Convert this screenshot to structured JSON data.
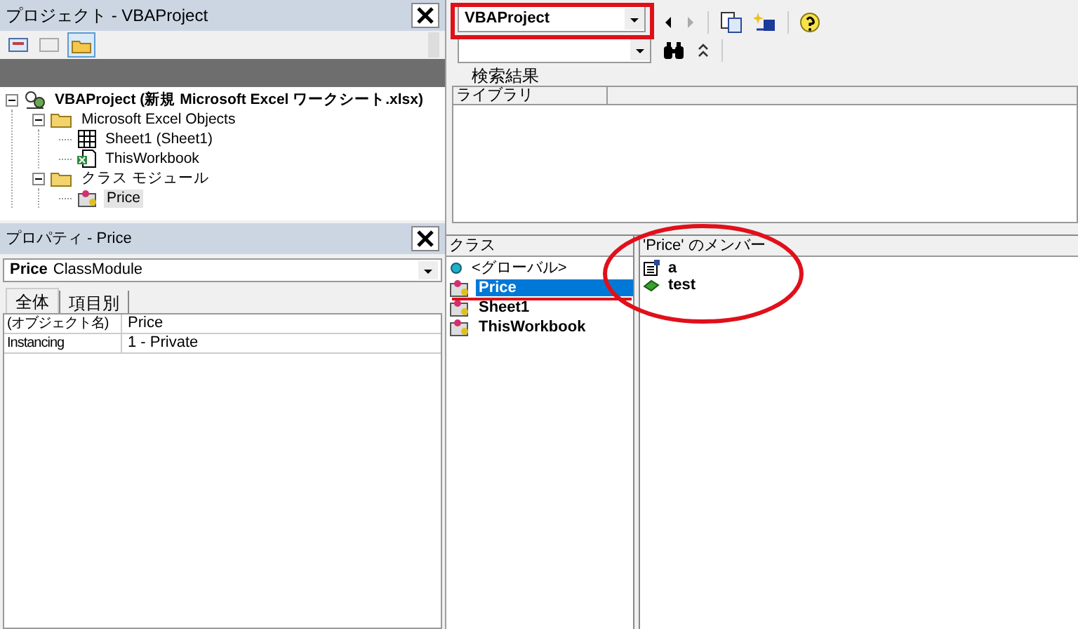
{
  "project_window": {
    "title": "プロジェクト - VBAProject",
    "tree": [
      {
        "label": "VBAProject (新規 Microsoft Excel ワークシート.xlsx)",
        "kind": "project",
        "expanded": true,
        "selected": false,
        "children": [
          {
            "label": "Microsoft Excel Objects",
            "kind": "folder",
            "expanded": true,
            "selected": false,
            "children": [
              {
                "label": "Sheet1 (Sheet1)",
                "kind": "sheet",
                "selected": false
              },
              {
                "label": "ThisWorkbook",
                "kind": "workbook",
                "selected": false
              }
            ]
          },
          {
            "label": "クラス モジュール",
            "kind": "folder",
            "expanded": true,
            "selected": false,
            "children": [
              {
                "label": "Price",
                "kind": "class",
                "selected": true
              }
            ]
          }
        ]
      }
    ]
  },
  "properties_window": {
    "title": "プロパティ - Price",
    "object": {
      "name": "Price",
      "type": "ClassModule"
    },
    "tabs": [
      {
        "label": "全体",
        "selected": true
      },
      {
        "label": "項目別",
        "selected": false
      }
    ],
    "rows": [
      {
        "name": "(オブジェクト名)",
        "value": "Price"
      },
      {
        "name": "Instancing",
        "value": "1 - Private"
      }
    ]
  },
  "object_browser": {
    "library": "VBAProject",
    "search_results_label": "検索結果",
    "results_columns": [
      "ライブラリ"
    ],
    "classes_header": "クラス",
    "classes": [
      {
        "label": "<グローバル>",
        "kind": "global",
        "selected": false
      },
      {
        "label": "Price",
        "kind": "class",
        "selected": true
      },
      {
        "label": "Sheet1",
        "kind": "class",
        "selected": false
      },
      {
        "label": "ThisWorkbook",
        "kind": "class",
        "selected": false
      }
    ],
    "members_header": "'Price' のメンバー",
    "members": [
      {
        "label": "a",
        "kind": "property"
      },
      {
        "label": "test",
        "kind": "method"
      }
    ]
  }
}
